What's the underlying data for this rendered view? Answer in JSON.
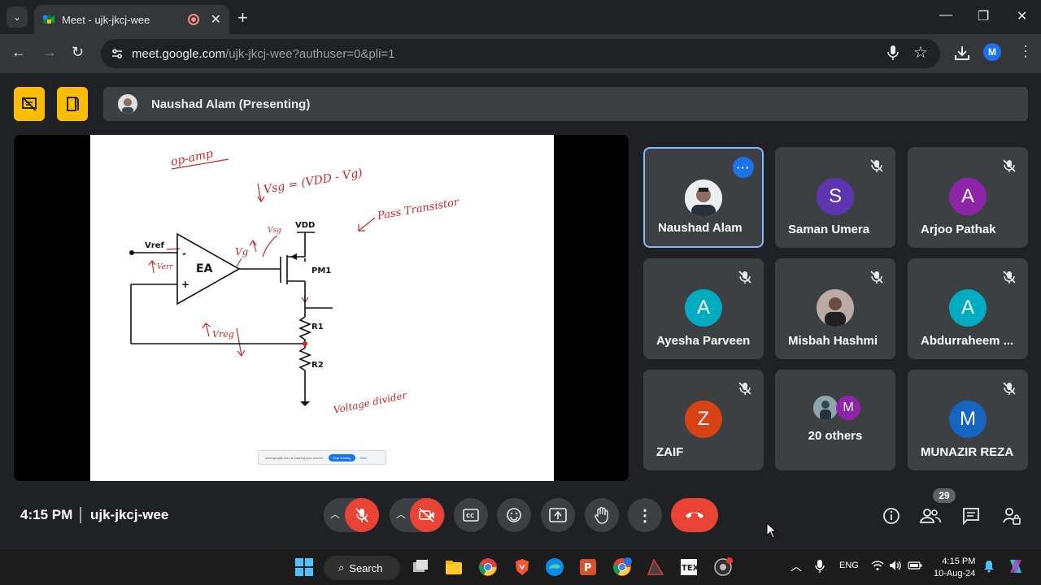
{
  "browser": {
    "tab_title": "Meet - ujk-jkcj-wee",
    "url_host": "meet.google.com",
    "url_path": "/ujk-jkcj-wee?authuser=0&pli=1",
    "profile_initial": "M"
  },
  "meet": {
    "presenter_label": "Naushad Alam (Presenting)",
    "time": "4:15 PM",
    "meeting_code": "ujk-jkcj-wee",
    "participant_count": "29",
    "share_notice": "meet.google.com is sharing your screen.",
    "stop_sharing": "Stop sharing",
    "hide": "Hide"
  },
  "slide": {
    "annotations": {
      "op_amp": "op-amp",
      "vsg_eq": "Vsg = (VDD - Vg)",
      "pass_transistor": "Pass Transistor",
      "vsg": "Vsg",
      "vg": "Vg",
      "verr": "Verr",
      "vreg": "Vreg",
      "voltage_divider": "Voltage divider"
    },
    "labels": {
      "vdd": "VDD",
      "vref": "Vref",
      "ea": "EA",
      "minus": "-",
      "plus": "+",
      "pm1": "PM1",
      "r1": "R1",
      "r2": "R2"
    }
  },
  "participants": [
    {
      "name": "Naushad Alam",
      "initial": "",
      "color": "",
      "muted": false,
      "active": true,
      "photo": true
    },
    {
      "name": "Saman Umera",
      "initial": "S",
      "color": "#5e35b1",
      "muted": true
    },
    {
      "name": "Arjoo Pathak",
      "initial": "A",
      "color": "#8e24aa",
      "muted": true
    },
    {
      "name": "Ayesha Parveen",
      "initial": "A",
      "color": "#00acc1",
      "muted": true
    },
    {
      "name": "Misbah Hashmi",
      "initial": "",
      "color": "",
      "muted": true,
      "photo": true
    },
    {
      "name": "Abdurraheem ...",
      "initial": "A",
      "color": "#00acc1",
      "muted": true
    },
    {
      "name": "ZAIF",
      "initial": "Z",
      "color": "#d84315",
      "muted": true
    },
    {
      "name": "20 others",
      "initial": "M",
      "color": "#8e24aa",
      "muted": false
    },
    {
      "name": "MUNAZIR REZA",
      "initial": "M",
      "color": "#1565c0",
      "muted": true
    }
  ],
  "taskbar": {
    "search_label": "Search",
    "lang": "ENG",
    "clock_time": "4:15 PM",
    "clock_date": "10-Aug-24"
  }
}
